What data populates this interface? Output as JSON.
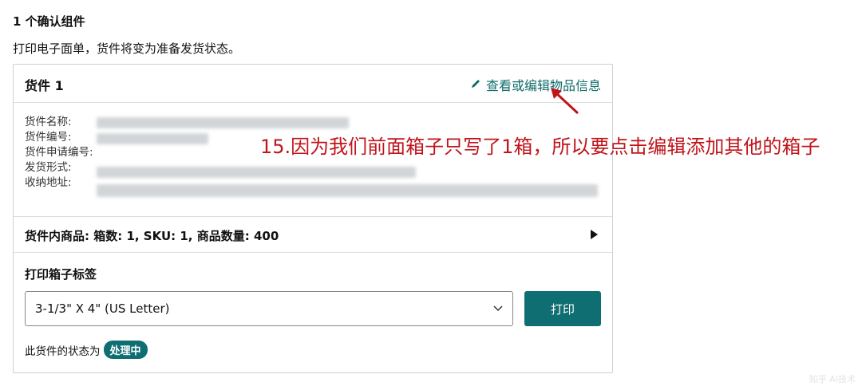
{
  "section": {
    "title": "1 个确认组件",
    "description": "打印电子面单，货件将变为准备发货状态。"
  },
  "shipment": {
    "title": "货件 1",
    "edit_link": "查看或编辑物品信息",
    "edit_icon": "pencil-icon",
    "info_labels": [
      "货件名称:",
      "货件编号:",
      "货件申请编号:",
      "发货形式:",
      "收纳地址:"
    ],
    "contents_summary": "货件内商品: 箱数: 1, SKU: 1, 商品数量: 400",
    "expand_icon": "triangle-right-icon"
  },
  "print_labels": {
    "title": "打印箱子标签",
    "selected_format": "3-1/3\" X 4\" (US Letter)",
    "print_button": "打印"
  },
  "status": {
    "prefix": "此货件的状态为",
    "badge": "处理中",
    "badge_color": "#0f6e72"
  },
  "annotation": {
    "text": "15.因为我们前面箱子只写了1箱，所以要点击编辑添加其他的箱子",
    "color": "#c0141b"
  },
  "watermark": "知乎 AI技术"
}
